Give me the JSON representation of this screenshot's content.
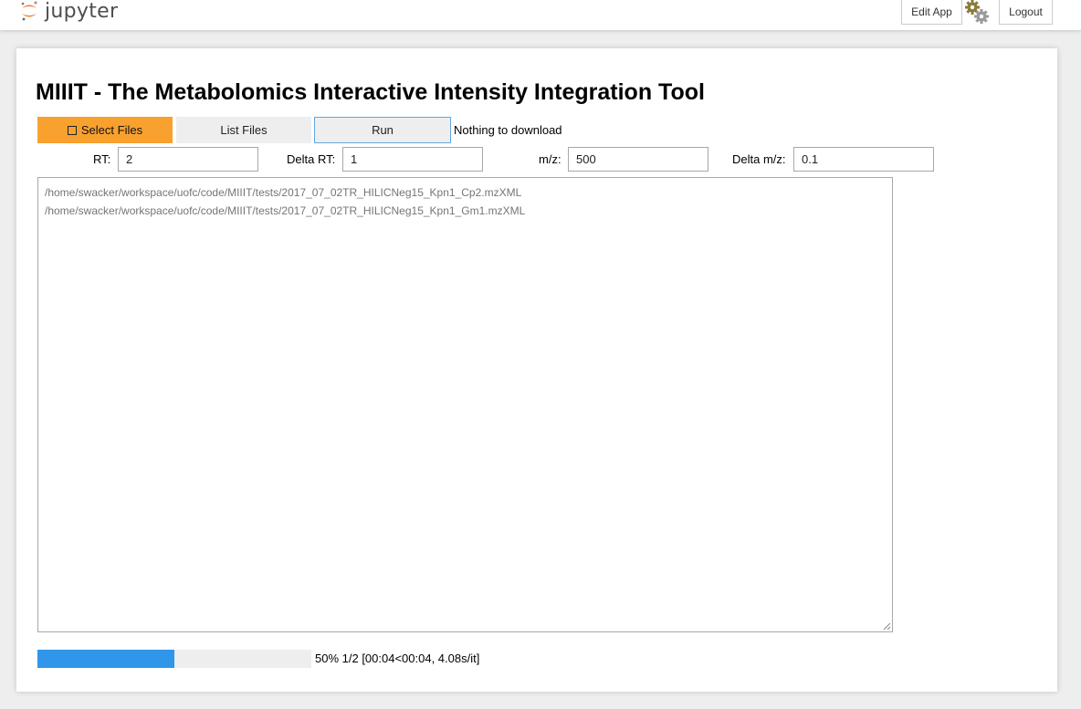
{
  "header": {
    "logo_text": "jupyter",
    "edit_app_label": "Edit App",
    "logout_label": "Logout",
    "icons": [
      "jupyter-logo-icon",
      "gears-icon"
    ]
  },
  "app": {
    "title": "MIIIT - The Metabolomics Interactive Intensity Integration Tool",
    "buttons": {
      "select_files": "Select Files",
      "list_files": "List Files",
      "run": "Run"
    },
    "download_status": "Nothing to download",
    "params": {
      "rt_label": "RT:",
      "rt_value": "2",
      "delta_rt_label": "Delta RT:",
      "delta_rt_value": "1",
      "mz_label": "m/z:",
      "mz_value": "500",
      "delta_mz_label": "Delta m/z:",
      "delta_mz_value": "0.1"
    },
    "files": [
      "/home/swacker/workspace/uofc/code/MIIIT/tests/2017_07_02TR_HILICNeg15_Kpn1_Cp2.mzXML",
      "/home/swacker/workspace/uofc/code/MIIIT/tests/2017_07_02TR_HILICNeg15_Kpn1_Gm1.mzXML"
    ],
    "progress": {
      "fraction": 0.5,
      "text": "50% 1/2 [00:04<00:04, 4.08s/it]"
    }
  },
  "colors": {
    "select_button": "#f9a12f",
    "progress_fill": "#2f96ea",
    "jupyter_orange": "#f37726"
  }
}
